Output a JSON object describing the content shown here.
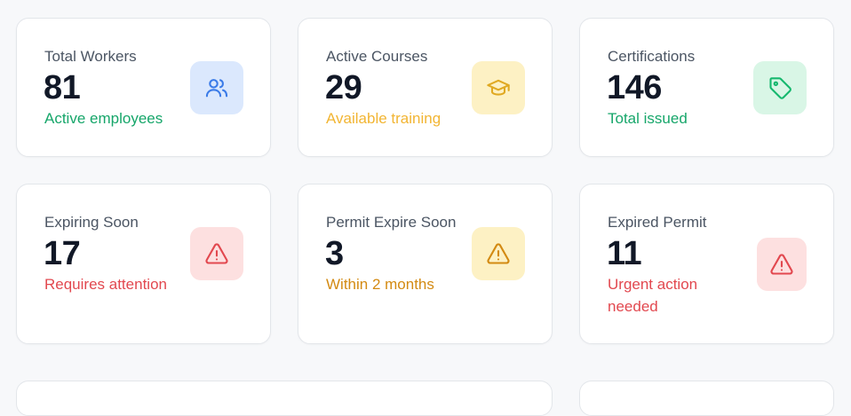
{
  "cards": [
    {
      "label": "Total Workers",
      "value": "81",
      "sub": "Active employees",
      "sub_color": "#16a66a",
      "icon": "users-icon",
      "icon_bg": "#dbe8fd",
      "icon_color": "#3b7be8"
    },
    {
      "label": "Active Courses",
      "value": "29",
      "sub": "Available training",
      "sub_color": "#f2b533",
      "icon": "graduation-cap-icon",
      "icon_bg": "#fdf1c4",
      "icon_color": "#e0a922"
    },
    {
      "label": "Certifications",
      "value": "146",
      "sub": "Total issued",
      "sub_color": "#16a66a",
      "icon": "tag-icon",
      "icon_bg": "#d9f6e6",
      "icon_color": "#16b86e"
    },
    {
      "label": "Expiring Soon",
      "value": "17",
      "sub": "Requires attention",
      "sub_color": "#e2484f",
      "icon": "alert-triangle-icon",
      "icon_bg": "#fde0e0",
      "icon_color": "#e2484f"
    },
    {
      "label": "Permit Expire Soon",
      "value": "3",
      "sub": "Within 2 months",
      "sub_color": "#d38a12",
      "icon": "alert-triangle-icon",
      "icon_bg": "#fdf1c4",
      "icon_color": "#d38a12"
    },
    {
      "label": "Expired Permit",
      "value": "11",
      "sub": "Urgent action needed",
      "sub_line1": "Urgent action",
      "sub_line2": "needed",
      "sub_color": "#e2484f",
      "icon": "alert-triangle-icon",
      "icon_bg": "#fde0e0",
      "icon_color": "#e2484f"
    }
  ]
}
